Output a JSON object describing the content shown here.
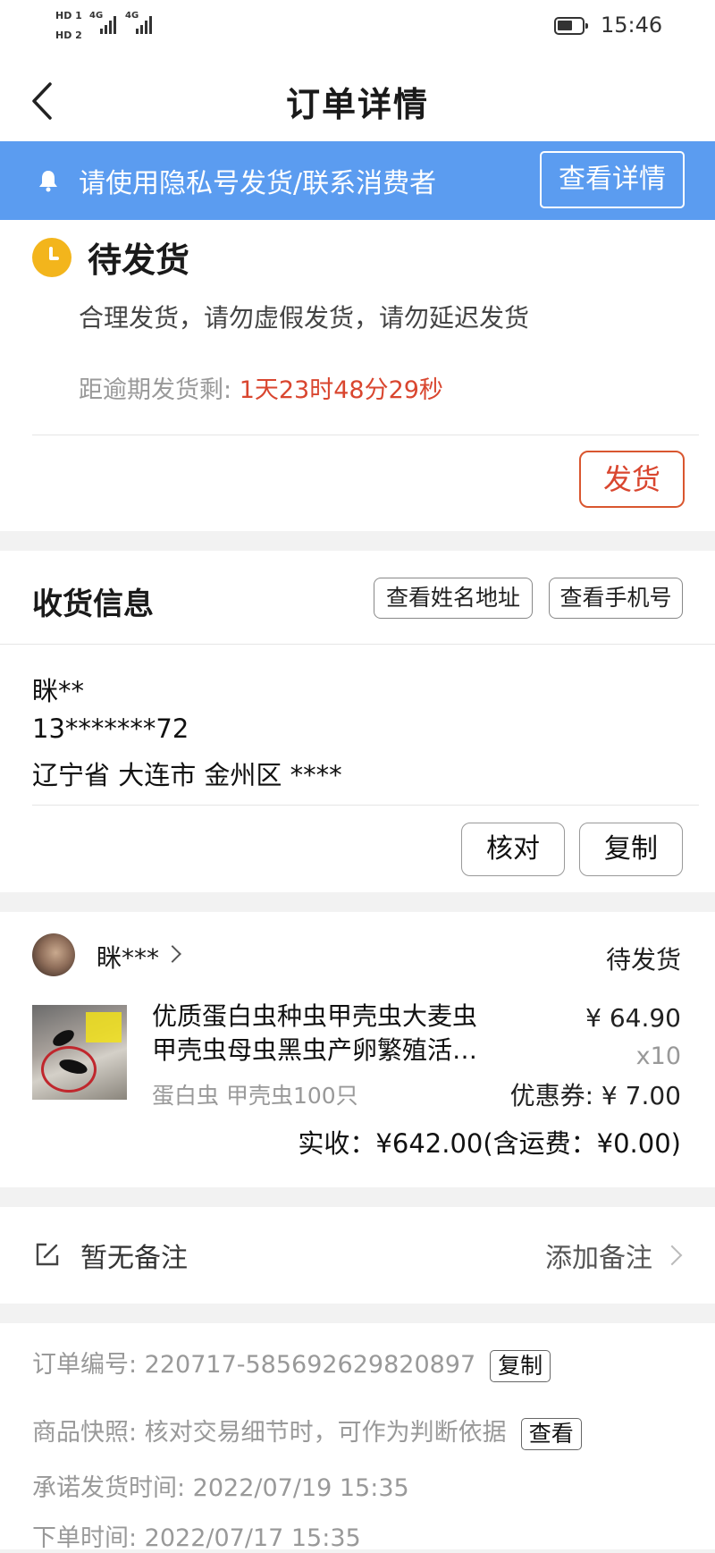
{
  "status_bar": {
    "sim1": "HD 1",
    "sim2": "HD 2",
    "net1": "4G",
    "net2": "4G",
    "time": "15:46"
  },
  "header": {
    "title": "订单详情"
  },
  "notice": {
    "text": "请使用隐私号发货/联系消费者",
    "button": "查看详情"
  },
  "order_status": {
    "title": "待发货",
    "desc": "合理发货，请勿虚假发货，请勿延迟发货",
    "countdown_label": "距逾期发货剩: ",
    "countdown_value": "1天23时48分29秒",
    "ship_button": "发货"
  },
  "shipping": {
    "title": "收货信息",
    "btn_view_name": "查看姓名地址",
    "btn_view_phone": "查看手机号",
    "name": "眯**",
    "phone": "13*******72",
    "address": "辽宁省 大连市 金州区 ****",
    "btn_check": "核对",
    "btn_copy": "复制"
  },
  "product": {
    "buyer": "眯***",
    "status": "待发货",
    "name_line1": "优质蛋白虫种虫甲壳虫大麦虫",
    "name_line2": "甲壳虫母虫黑虫产卵繁殖活…",
    "sku": "蛋白虫 甲壳虫100只",
    "price": "¥ 64.90",
    "quantity": "x10",
    "coupon": "优惠券: ¥ 7.00",
    "total": "实收：¥642.00(含运费：¥0.00)"
  },
  "remark": {
    "text": "暂无备注",
    "add": "添加备注"
  },
  "order_info": {
    "order_no": "订单编号: 220717-585692629820897",
    "copy_btn": "复制",
    "snapshot": "商品快照: 核对交易细节时，可作为判断依据",
    "snapshot_btn": "查看",
    "promise_time": "承诺发货时间: 2022/07/19 15:35",
    "order_time": "下单时间: 2022/07/17 15:35"
  },
  "colors": {
    "notice_bg": "#5b9cf0",
    "accent_red": "#d9462f",
    "status_yellow": "#f3b51c"
  }
}
